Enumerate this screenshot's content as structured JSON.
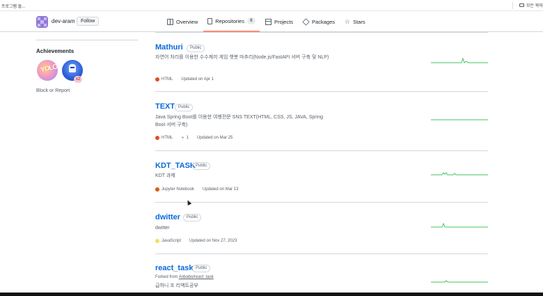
{
  "browser": {
    "bookmarks_left": "프로그램 돌...",
    "bookmarks_right": "모든 북마"
  },
  "profile": {
    "username": "dev-aram",
    "follow_label": "Follow"
  },
  "tabs": [
    {
      "label": "Overview",
      "icon": "book-icon"
    },
    {
      "label": "Repositories",
      "icon": "repo-icon",
      "count": "8",
      "active": true
    },
    {
      "label": "Projects",
      "icon": "project-icon"
    },
    {
      "label": "Packages",
      "icon": "package-icon"
    },
    {
      "label": "Stars",
      "icon": "star-icon"
    }
  ],
  "sidebar": {
    "achievements_title": "Achievements",
    "badge_multiplier": "x2",
    "block_report": "Block or Report"
  },
  "repos": [
    {
      "name": "Mathuri",
      "visibility": "Public",
      "description": "자연어 처리를 이용한 수수께끼 게임 챗봇 마추리(Node.js/FastAPI 서버 구축 및 NLP)",
      "language": "HTML",
      "language_color": "#e34c26",
      "updated": "Updated on Apr 1"
    },
    {
      "name": "TEXT",
      "visibility": "Public",
      "description": "Java Spring Boot를 이용한 여행전문 SNS TEXT(HTML, CSS, JS, JAVA, Spring Boot 서버 구축)",
      "language": "HTML",
      "language_color": "#e34c26",
      "forks": "1",
      "updated": "Updated on Mar 25"
    },
    {
      "name": "KDT_TASK",
      "visibility": "Public",
      "description": "KDT 과제",
      "language": "Jupyter Notebook",
      "language_color": "#DA5B0B",
      "updated": "Updated on Mar 13"
    },
    {
      "name": "dwitter",
      "visibility": "Public",
      "description": "dwitter",
      "language": "JavaScript",
      "language_color": "#f1e05a",
      "updated": "Updated on Nov 27, 2023"
    },
    {
      "name": "react_task",
      "visibility": "Public",
      "forked_prefix": "Forked from ",
      "forked_from": "Anbabo/react_task",
      "description": "급하니 조 리액트공부"
    }
  ],
  "colors": {
    "link": "#0969da",
    "tab_underline": "#fd8c73",
    "sparkline": "#40c463"
  }
}
